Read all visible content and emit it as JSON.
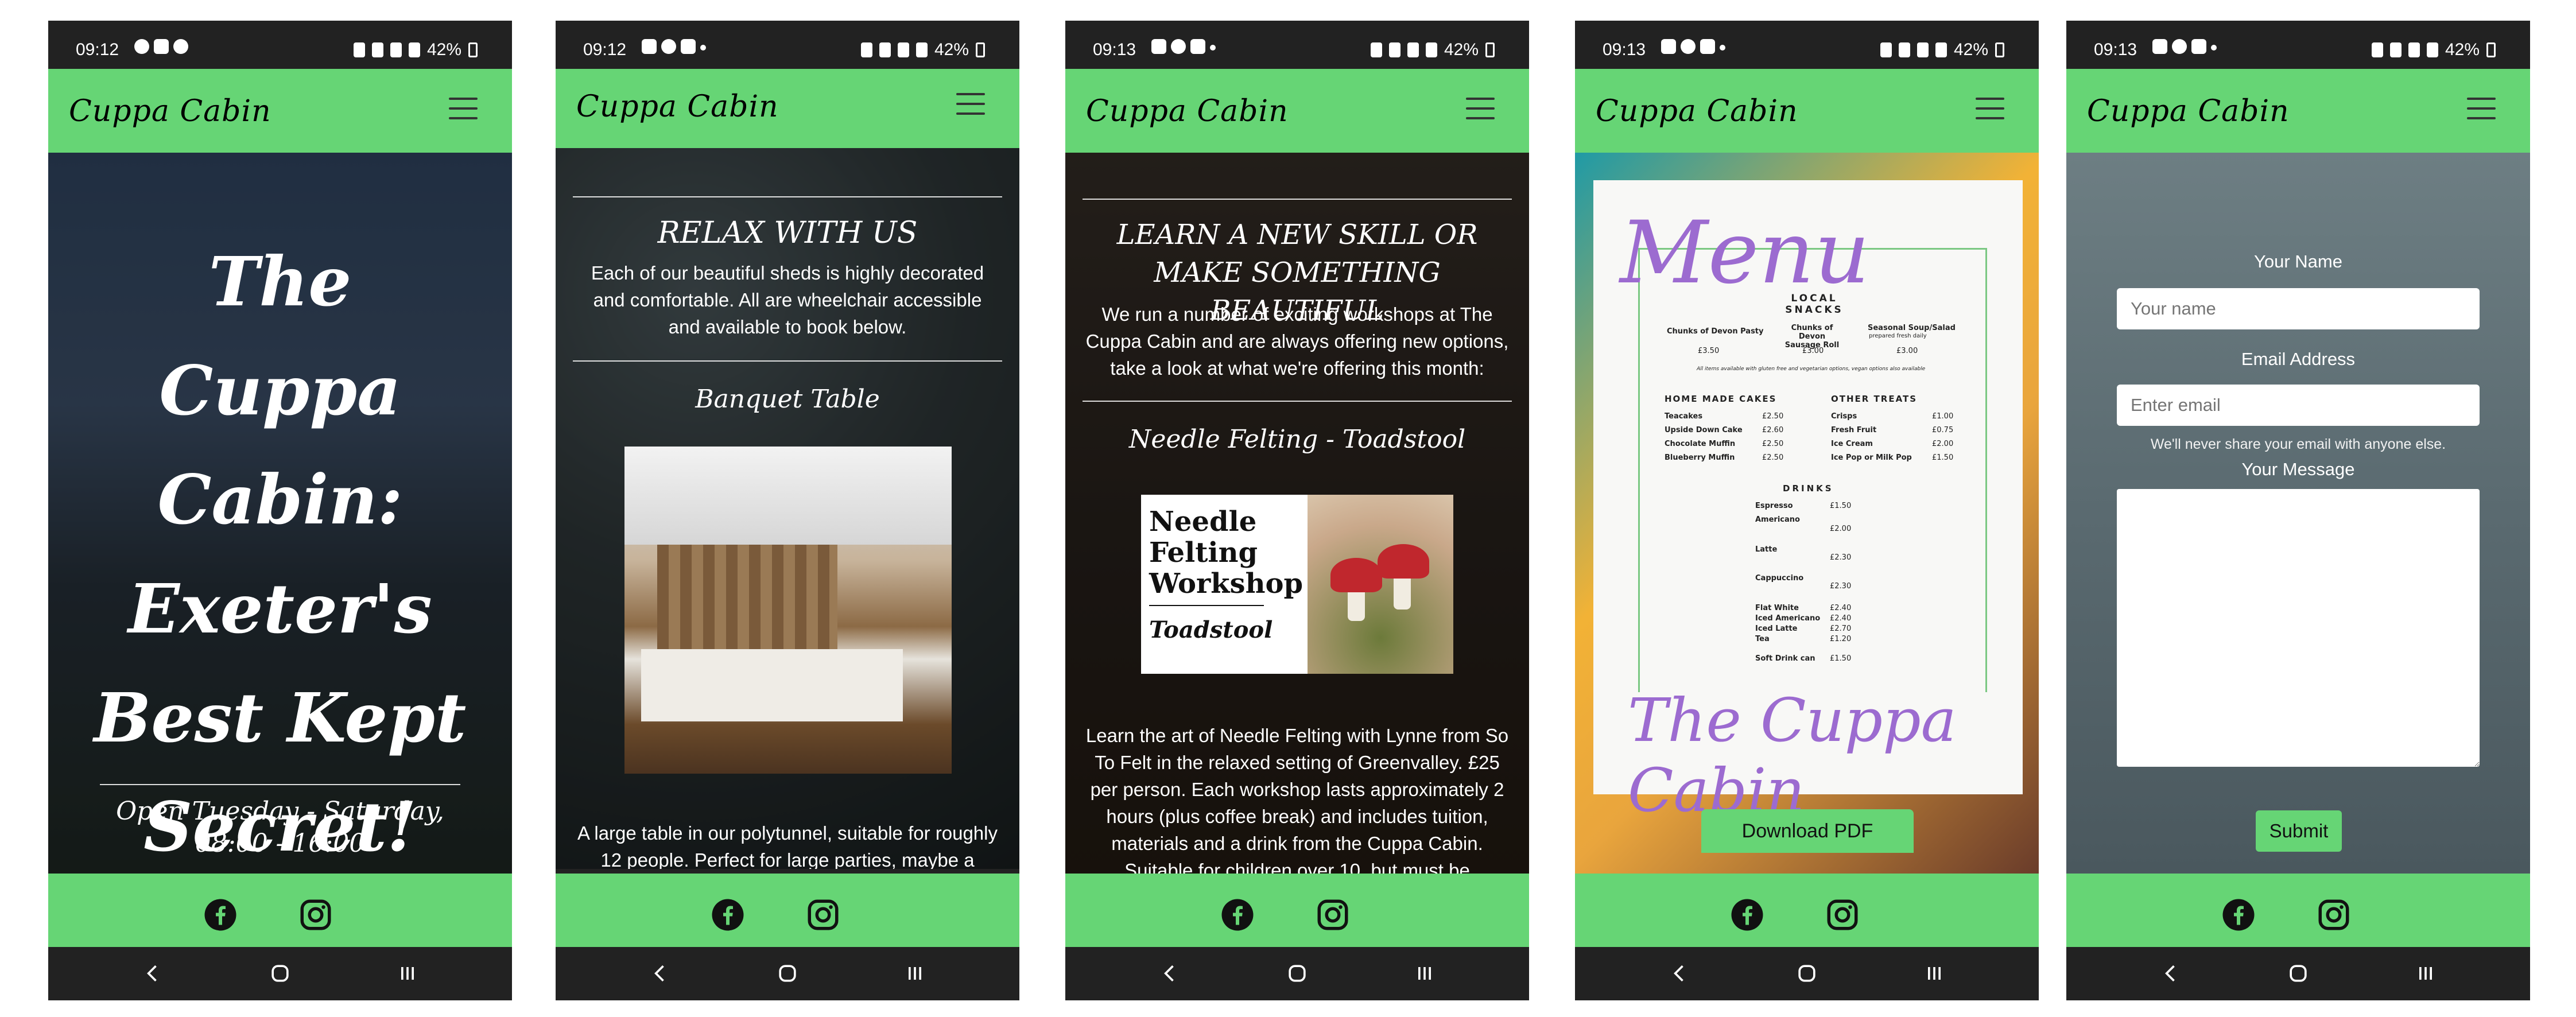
{
  "status": {
    "phone1_time": "09:12",
    "phone2_time": "09:12",
    "phone3_time": "09:13",
    "phone4_time": "09:13",
    "phone5_time": "09:13",
    "battery": "42%"
  },
  "nav": {
    "brand": "Cuppa Cabin"
  },
  "colors": {
    "accent_green": "#66d575",
    "menu_purple": "#9c6bd0"
  },
  "icons": {
    "facebook": "facebook-icon",
    "instagram": "instagram-icon",
    "back": "back-icon",
    "home": "home-icon",
    "recents": "recents-icon",
    "menu": "hamburger-icon"
  },
  "hero": {
    "title": "The Cuppa Cabin: Exeter's Best Kept Secret!",
    "subtitle": "Open Tuesday - Saturday, 08:00 - 16:00"
  },
  "sheds": {
    "heading": "RELAX WITH US",
    "intro": "Each of our beautiful sheds is highly decorated and comfortable. All are wheelchair accessible and available to book below.",
    "item_title": "Banquet Table",
    "item_desc": "A large table in our polytunnel, suitable for roughly 12 people. Perfect for large parties, maybe a special"
  },
  "workshops": {
    "heading": "LEARN A NEW SKILL OR MAKE SOMETHING BEAUTIFUL",
    "intro": "We run a number of exciting workshops at The Cuppa Cabin and are always offering new options, take a look at what we're offering this month:",
    "item_title": "Needle Felting - Toadstool",
    "image_line1": "Needle",
    "image_line2": "Felting",
    "image_line3": "Workshop",
    "image_line4": "Toadstool",
    "item_desc": "Learn the art of Needle Felting with Lynne from So To Felt in the relaxed setting of Greenvalley. £25 per person. Each workshop lasts approximately 2 hours (plus coffee break) and includes tuition, materials and a drink from the Cuppa Cabin. Suitable for children over 10, but must be supervised by an adult."
  },
  "menu": {
    "title_word": "Menu",
    "brand_script": "The Cuppa Cabin",
    "local_snacks": "LOCAL SNACKS",
    "snack1": "Chunks of Devon Pasty",
    "snack2": "Chunks of Devon Sausage Roll",
    "snack3": "Seasonal Soup/Salad",
    "snack3_note": "prepared fresh daily",
    "snack1_price": "£3.50",
    "snack2_price": "£3.00",
    "snack3_price": "£3.00",
    "snack_note": "All items available with gluten free and vegetarian options, vegan options also available",
    "cakes_heading": "HOME MADE CAKES",
    "cake1": "Teacakes",
    "cake1_price": "£2.50",
    "cake2": "Upside Down Cake",
    "cake2_price": "£2.60",
    "cake3": "Chocolate Muffin",
    "cake3_price": "£2.50",
    "cake4": "Blueberry Muffin",
    "cake4_price": "£2.50",
    "treats_heading": "OTHER TREATS",
    "treat1": "Crisps",
    "treat1_price": "£1.00",
    "treat2": "Fresh Fruit",
    "treat2_price": "£0.75",
    "treat3": "Ice Cream",
    "treat3_price": "£2.00",
    "treat4": "Ice Pop or Milk Pop",
    "treat4_price": "£1.50",
    "drinks_heading": "DRINKS",
    "drink1": "Espresso",
    "drink1_price": "£1.50",
    "drink2": "Americano",
    "drink2_price": "£2.00",
    "drink3": "Latte",
    "drink3_price": "£2.30",
    "drink4": "Cappuccino",
    "drink4_price": "£2.30",
    "drink5": "Flat White",
    "drink5_price": "£2.40",
    "drink6": "Iced Americano",
    "drink6_price": "£2.40",
    "drink7": "Iced Latte",
    "drink7_price": "£2.70",
    "drink8": "Tea",
    "drink8_price": "£1.20",
    "drink9": "Soft Drink can",
    "drink9_price": "£1.50",
    "download_label": "Download PDF"
  },
  "form": {
    "name_label": "Your Name",
    "name_placeholder": "Your name",
    "email_label": "Email Address",
    "email_placeholder": "Enter email",
    "email_help": "We'll never share your email with anyone else.",
    "message_label": "Your Message",
    "submit_label": "Submit"
  }
}
